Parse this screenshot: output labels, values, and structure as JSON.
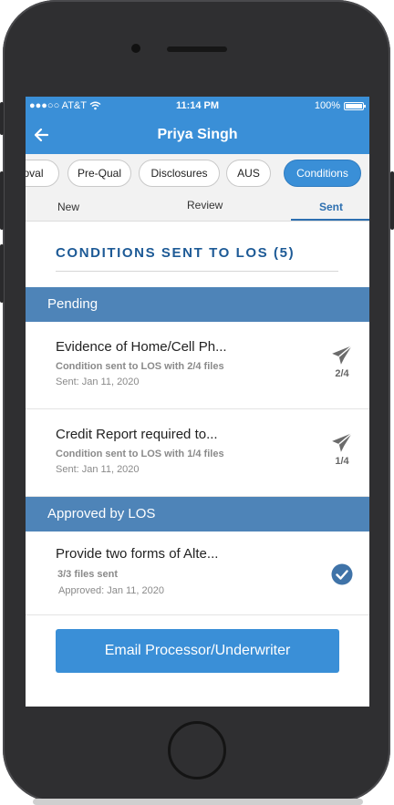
{
  "status_bar": {
    "carrier": "●●●○○ AT&T",
    "time": "11:14 PM",
    "battery_text": "100%"
  },
  "header": {
    "title": "Priya Singh",
    "back_icon": "arrow-left-icon"
  },
  "stage_tabs": [
    {
      "label": "oval",
      "active": false
    },
    {
      "label": "Pre-Qual",
      "active": false
    },
    {
      "label": "Disclosures",
      "active": false
    },
    {
      "label": "AUS",
      "active": false
    },
    {
      "label": "Conditions",
      "active": true
    }
  ],
  "sub_tabs": [
    {
      "label": "New",
      "active": false
    },
    {
      "label": "Review",
      "active": false
    },
    {
      "label": "Sent",
      "active": true
    }
  ],
  "section_title": "CONDITIONS SENT TO LOS (5)",
  "groups": {
    "pending": {
      "header": "Pending",
      "items": [
        {
          "title": "Evidence of Home/Cell Ph...",
          "subtitle": "Condition sent to LOS with 2/4 files",
          "date": "Sent: Jan 11, 2020",
          "count": "2/4",
          "icon": "paper-plane-icon"
        },
        {
          "title": "Credit Report required to...",
          "subtitle": "Condition sent to LOS with 1/4 files",
          "date": "Sent: Jan 11, 2020",
          "count": "1/4",
          "icon": "paper-plane-icon"
        }
      ]
    },
    "approved": {
      "header": "Approved by LOS",
      "items": [
        {
          "title": "Provide two forms of Alte...",
          "subtitle": "3/3 files sent",
          "date": "Approved: Jan 11, 2020",
          "icon": "check-circle-icon"
        }
      ]
    }
  },
  "email_button": "Email Processor/Underwriter",
  "colors": {
    "brand_blue": "#3a8fd7",
    "group_header": "#4e84b8",
    "title_blue": "#1d5a96",
    "icon_gray": "#6b6b6b",
    "check_blue": "#3f73a8"
  }
}
